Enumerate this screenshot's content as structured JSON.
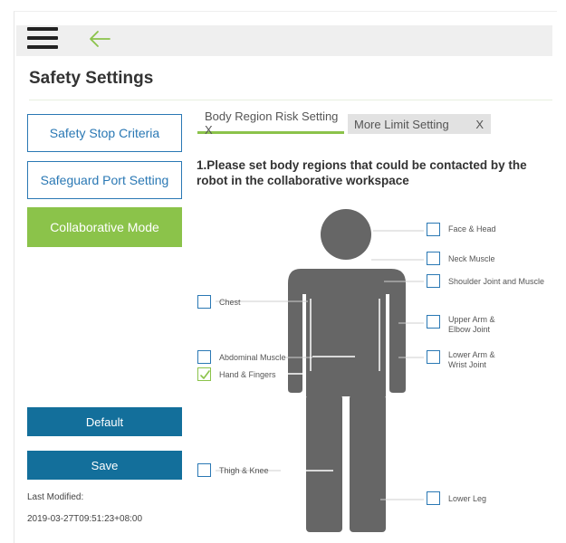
{
  "page": {
    "title": "Safety Settings"
  },
  "sidebar": {
    "items": [
      {
        "label": "Safety Stop Criteria"
      },
      {
        "label": "Safeguard Port Setting"
      },
      {
        "label": "Collaborative Mode"
      }
    ],
    "default_label": "Default",
    "save_label": "Save",
    "last_modified_label": "Last Modified:",
    "last_modified_value": "2019-03-27T09:51:23+08:00"
  },
  "tabs": [
    {
      "label": "Body Region Risk Setting X"
    },
    {
      "label": "More Limit Setting",
      "close": "X"
    }
  ],
  "instructions": "1.Please set body regions that could be contacted by the robot in the collaborative workspace",
  "regions": [
    {
      "label": "Face & Head",
      "checked": false
    },
    {
      "label": "Neck Muscle",
      "checked": false
    },
    {
      "label": "Shoulder Joint and Muscle",
      "checked": false
    },
    {
      "label": "Chest",
      "checked": false
    },
    {
      "label_line1": "Upper Arm &",
      "label_line2": "Elbow Joint",
      "checked": false
    },
    {
      "label": "Abdominal Muscle",
      "checked": false
    },
    {
      "label_line1": "Lower Arm &",
      "label_line2": "Wrist Joint",
      "checked": false
    },
    {
      "label": "Hand & Fingers",
      "checked": true
    },
    {
      "label": "Thigh & Knee",
      "checked": false
    },
    {
      "label": "Lower Leg",
      "checked": false
    }
  ],
  "colors": {
    "accent_green": "#8bc34a",
    "primary_blue": "#136f9b",
    "outline_blue": "#2a78b4",
    "figure_gray": "#666666"
  },
  "icons": {
    "menu": "hamburger-menu-icon",
    "back": "back-arrow-icon",
    "check": "checkmark-icon"
  }
}
